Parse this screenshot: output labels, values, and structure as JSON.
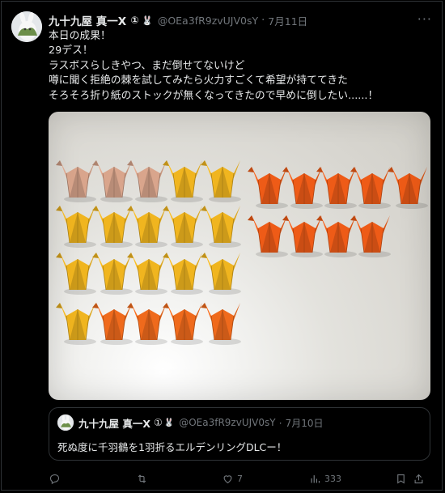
{
  "post": {
    "author_name": "九十九屋 真一X",
    "badge_symbol": "①",
    "badge_emoji": "🐰",
    "handle": "@OEa3fR9zvUJV0sY",
    "separator": "·",
    "date": "7月11日",
    "more_glyph": "···",
    "lines": [
      "本日の成果！",
      "29デス！",
      "ラスボスらしきやつ、まだ倒せてないけど",
      "噂に聞く拒絶の棘を試してみたら火力すごくて希望が持ててきた",
      "そろそろ折り紙のストックが無くなってきたので早めに倒したい......！"
    ]
  },
  "photo": {
    "cranes": [
      {
        "row": 0,
        "col": 0,
        "color": "#d9a58c"
      },
      {
        "row": 0,
        "col": 1,
        "color": "#d9a58c"
      },
      {
        "row": 0,
        "col": 2,
        "color": "#d9a58c"
      },
      {
        "row": 0,
        "col": 3,
        "color": "#f0b51f"
      },
      {
        "row": 0,
        "col": 4,
        "color": "#f0b51f"
      },
      {
        "row": 1,
        "col": 0,
        "color": "#f0b51f"
      },
      {
        "row": 1,
        "col": 1,
        "color": "#f0b51f"
      },
      {
        "row": 1,
        "col": 2,
        "color": "#f0b51f"
      },
      {
        "row": 1,
        "col": 3,
        "color": "#f0b51f"
      },
      {
        "row": 1,
        "col": 4,
        "color": "#f0b51f"
      },
      {
        "row": 2,
        "col": 0,
        "color": "#f0b51f"
      },
      {
        "row": 2,
        "col": 1,
        "color": "#f0b51f"
      },
      {
        "row": 2,
        "col": 2,
        "color": "#f0b51f"
      },
      {
        "row": 2,
        "col": 3,
        "color": "#f0b51f"
      },
      {
        "row": 2,
        "col": 4,
        "color": "#f0b51f"
      },
      {
        "row": 3,
        "col": 0,
        "color": "#f0b51f"
      },
      {
        "row": 3,
        "col": 1,
        "color": "#ef6a1c"
      },
      {
        "row": 3,
        "col": 2,
        "color": "#ef6a1c"
      },
      {
        "row": 3,
        "col": 3,
        "color": "#ef6a1c"
      },
      {
        "row": 3,
        "col": 4,
        "color": "#ef6a1c"
      },
      {
        "row": 0,
        "col": 5,
        "color": "#ee5b17"
      },
      {
        "row": 0,
        "col": 6,
        "color": "#ee5b17"
      },
      {
        "row": 0,
        "col": 7,
        "color": "#ee5b17"
      },
      {
        "row": 0,
        "col": 8,
        "color": "#ee5b17"
      },
      {
        "row": 0,
        "col": 9,
        "color": "#ee5b17"
      },
      {
        "row": 1,
        "col": 5,
        "color": "#ee5b17"
      },
      {
        "row": 1,
        "col": 6,
        "color": "#ee5b17"
      },
      {
        "row": 1,
        "col": 7,
        "color": "#ee5b17"
      },
      {
        "row": 1,
        "col": 8,
        "color": "#ee5b17"
      }
    ]
  },
  "quote": {
    "author_name": "九十九屋 真一X",
    "badge_symbol": "①",
    "badge_emoji": "🐰",
    "handle": "@OEa3fR9zvUJV0sY",
    "separator": "·",
    "date": "7月10日",
    "text": "死ぬ度に千羽鶴を1羽折るエルデンリングDLCー！"
  },
  "actions": {
    "reply_count": "",
    "repost_count": "",
    "like_count": "7",
    "view_count": "333"
  },
  "colors": {
    "background": "#000000",
    "text": "#e7e9ea",
    "muted": "#71767b",
    "border": "#2f3336"
  }
}
